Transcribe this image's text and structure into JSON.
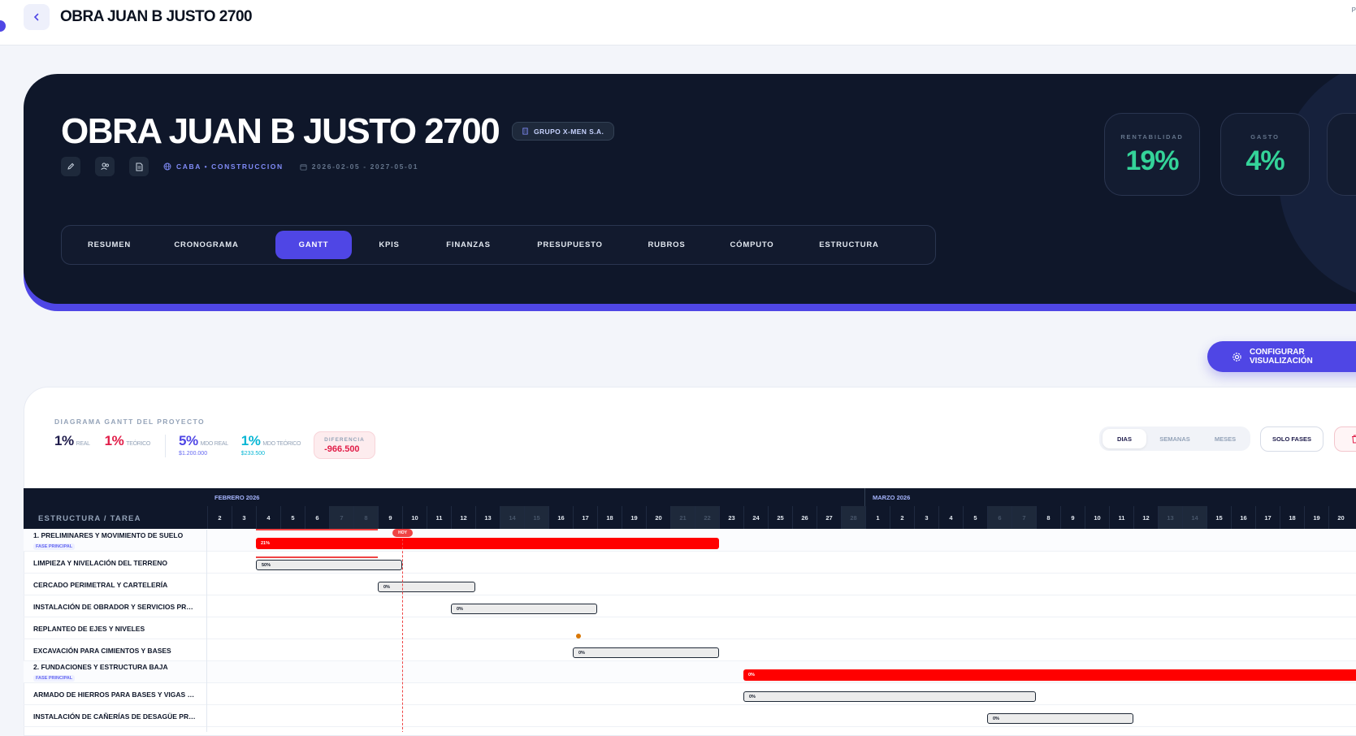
{
  "topbar": {
    "title": "OBRA JUAN B JUSTO 2700",
    "right_text": "P"
  },
  "hero": {
    "title": "OBRA JUAN B JUSTO 2700",
    "company": "GRUPO X-MEN S.A.",
    "location": "CABA • CONSTRUCCION",
    "dates": "2026-02-05 - 2027-05-01",
    "kpis": [
      {
        "label": "RENTABILIDAD",
        "value": "19%"
      },
      {
        "label": "GASTO",
        "value": "4%"
      }
    ],
    "tabs": [
      "RESUMEN",
      "CRONOGRAMA",
      "GANTT",
      "KPIS",
      "FINANZAS",
      "PRESUPUESTO",
      "RUBROS",
      "CÓMPUTO",
      "ESTRUCTURA"
    ],
    "active_tab": "GANTT",
    "accent_color": "#4f46e5",
    "kpi_color": "#34d399"
  },
  "config_button": "CONFIGURAR VISUALIZACIÓN",
  "gantt": {
    "header_label": "DIAGRAMA GANTT DEL PROYECTO",
    "stats": {
      "real": {
        "value": "1%",
        "label": "REAL"
      },
      "teorico": {
        "value": "1%",
        "label": "TEÓRICO"
      },
      "mdo_real": {
        "value": "5%",
        "label": "MDO REAL",
        "sub": "$1.200.000"
      },
      "mdo_teorico": {
        "value": "1%",
        "label": "MDO TEÓRICO",
        "sub": "$233.500"
      },
      "diferencia": {
        "label": "DIFERENCIA",
        "value": "-966.500"
      }
    },
    "view_modes": [
      "DIAS",
      "SEMANAS",
      "MESES"
    ],
    "active_view": "DIAS",
    "solo_fases": "SOLO FASES",
    "column_title": "ESTRUCTURA / TAREA",
    "months": [
      "FEBRERO 2026",
      "MARZO 2026"
    ],
    "days": [
      "2",
      "3",
      "4",
      "5",
      "6",
      "7",
      "8",
      "9",
      "10",
      "11",
      "12",
      "13",
      "14",
      "15",
      "16",
      "17",
      "18",
      "19",
      "20",
      "21",
      "22",
      "23",
      "24",
      "25",
      "26",
      "27",
      "28",
      "1",
      "2",
      "3",
      "4",
      "5",
      "6",
      "7",
      "8",
      "9",
      "10",
      "11",
      "12",
      "13",
      "14",
      "15",
      "16",
      "17",
      "18",
      "19",
      "20"
    ],
    "today_label": "HOY",
    "phase_tag": "FASE PRINCIPAL",
    "rows": [
      {
        "name": "1. PRELIMINARES Y MOVIMIENTO DE SUELO",
        "phase": true,
        "progress": "21%"
      },
      {
        "name": "LIMPIEZA Y NIVELACIÓN DEL TERRENO",
        "phase": false,
        "progress": "50%"
      },
      {
        "name": "CERCADO PERIMETRAL Y CARTELERÍA",
        "phase": false,
        "progress": "0%"
      },
      {
        "name": "INSTALACIÓN DE OBRADOR Y SERVICIOS PRO...",
        "phase": false,
        "progress": "0%"
      },
      {
        "name": "REPLANTEO DE EJES Y NIVELES",
        "phase": false,
        "progress": ""
      },
      {
        "name": "EXCAVACIÓN PARA CIMIENTOS Y BASES",
        "phase": false,
        "progress": "0%"
      },
      {
        "name": "2. FUNDACIONES Y ESTRUCTURA BAJA",
        "phase": true,
        "progress": "0%"
      },
      {
        "name": "ARMADO DE HIERROS PARA BASES Y VIGAS D...",
        "phase": false,
        "progress": "0%"
      },
      {
        "name": "INSTALACIÓN DE CAÑERÍAS DE DESAGÜE PRI...",
        "phase": false,
        "progress": "0%"
      }
    ],
    "phase_color": "#ff0000",
    "today_color": "#ef4444"
  }
}
